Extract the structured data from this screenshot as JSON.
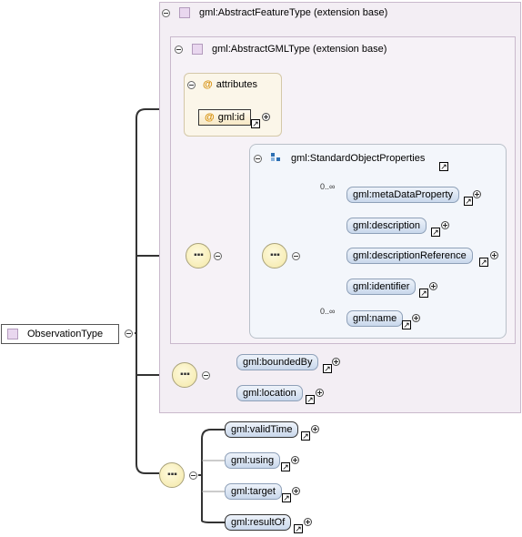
{
  "root": {
    "label": "ObservationType"
  },
  "feature_ext": {
    "label": "gml:AbstractFeatureType (extension base)"
  },
  "gml_ext": {
    "label": "gml:AbstractGMLType (extension base)"
  },
  "attributes": {
    "label": "attributes",
    "items": [
      {
        "label": "gml:id"
      }
    ]
  },
  "std_props": {
    "label": "gml:StandardObjectProperties",
    "elements": [
      {
        "label": "gml:metaDataProperty",
        "card": "0..∞"
      },
      {
        "label": "gml:description",
        "card": ""
      },
      {
        "label": "gml:descriptionReference",
        "card": ""
      },
      {
        "label": "gml:identifier",
        "card": ""
      },
      {
        "label": "gml:name",
        "card": "0..∞"
      }
    ]
  },
  "feature_elements": [
    {
      "label": "gml:boundedBy"
    },
    {
      "label": "gml:location"
    }
  ],
  "obs_elements": [
    {
      "label": "gml:validTime"
    },
    {
      "label": "gml:using"
    },
    {
      "label": "gml:target"
    },
    {
      "label": "gml:resultOf"
    }
  ],
  "glyphs": {
    "sequence_icon": "sequence-compositor-icon",
    "ref_arrow": "↗"
  },
  "colors": {
    "ext_bg": "#f3eef4",
    "std_bg": "#f3f6fb",
    "attr_bg": "#fbf6e9",
    "element_bg": "#c9d8ec",
    "seq_bg": "#f3e7a5"
  }
}
